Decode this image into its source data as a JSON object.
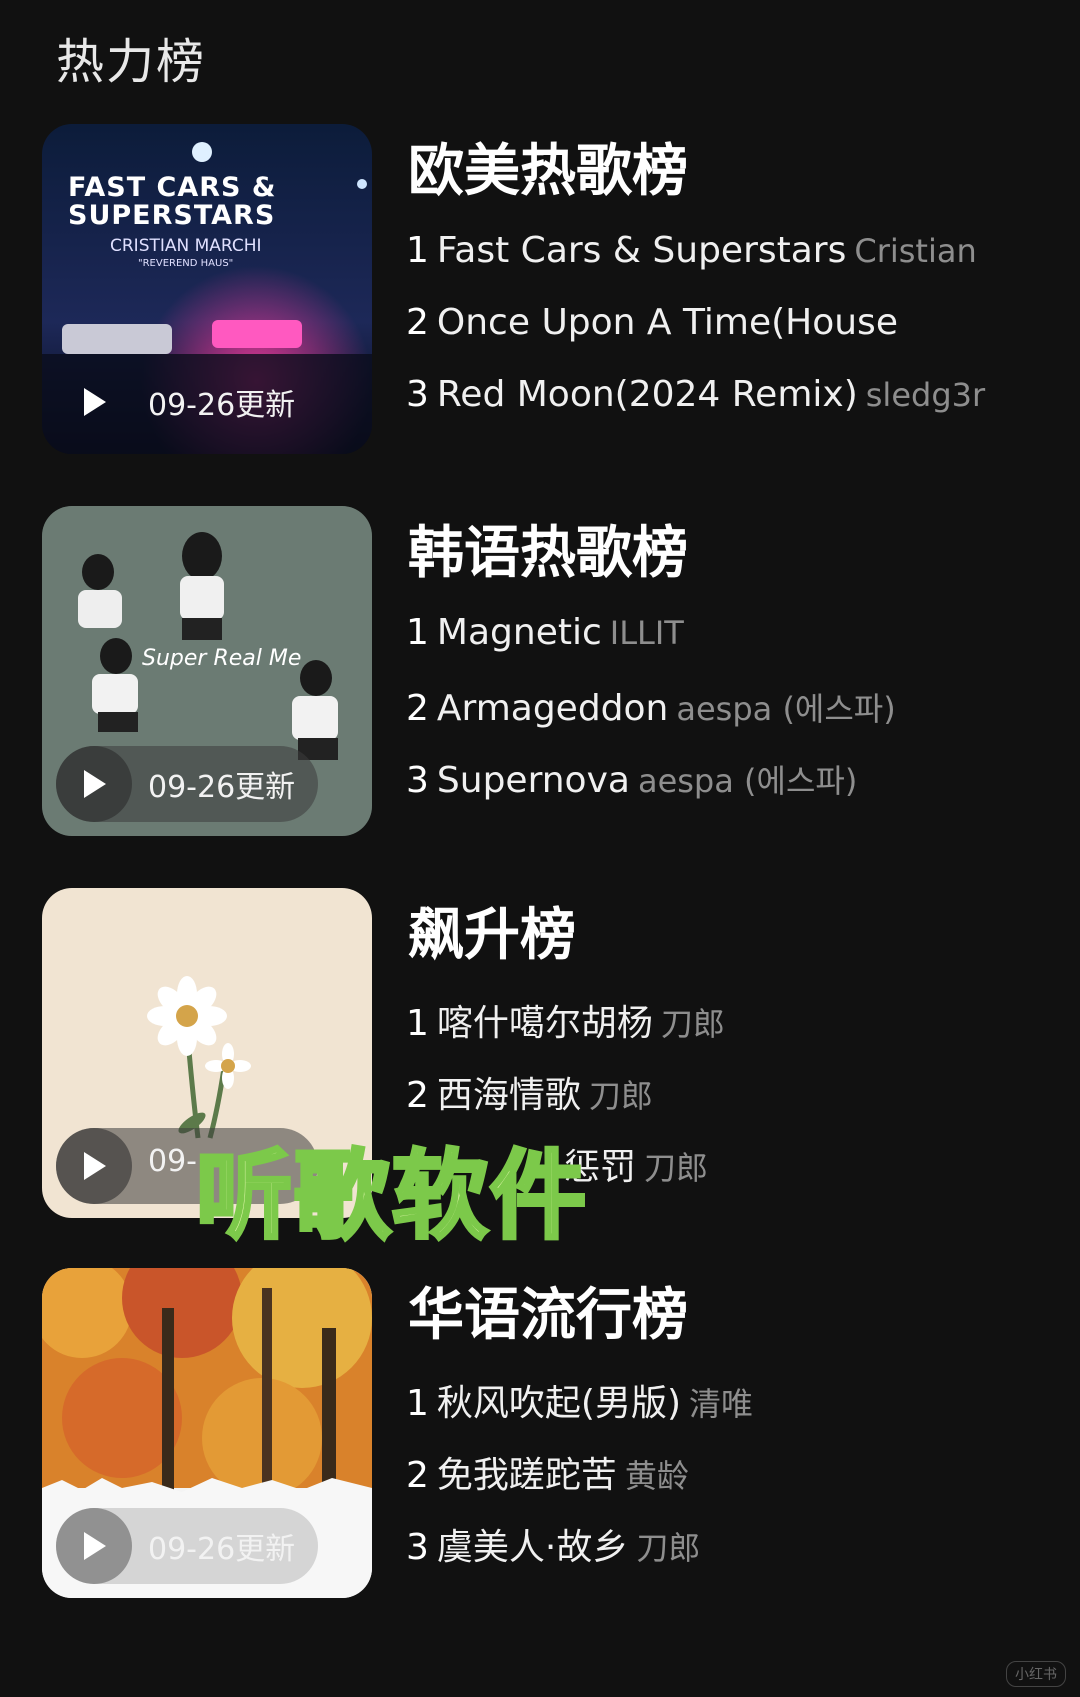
{
  "page": {
    "title": "热力榜"
  },
  "charts": [
    {
      "name": "欧美热歌榜",
      "update": "09-26更新",
      "cover_text": {
        "title": "FAST CARS & SUPERSTARS",
        "artist": "CRISTIAN MARCHI",
        "sub": "\"REVEREND HAUS\""
      },
      "tracks": [
        {
          "rank": "1",
          "title": "Fast Cars & Superstars",
          "artist": "Cristian"
        },
        {
          "rank": "2",
          "title": "Once Upon A Time(House",
          "artist": ""
        },
        {
          "rank": "3",
          "title": "Red Moon(2024 Remix)",
          "artist": "sledg3r"
        }
      ]
    },
    {
      "name": "韩语热歌榜",
      "update": "09-26更新",
      "cover_text": {
        "title": "Super Real Me"
      },
      "tracks": [
        {
          "rank": "1",
          "title": "Magnetic",
          "artist": "ILLIT"
        },
        {
          "rank": "2",
          "title": "Armageddon",
          "artist": "aespa (에스파)"
        },
        {
          "rank": "3",
          "title": "Supernova",
          "artist": "aespa (에스파)"
        }
      ]
    },
    {
      "name": "飙升榜",
      "update": "09-",
      "tracks": [
        {
          "rank": "1",
          "title": "喀什噶尔胡杨",
          "artist": "刀郎"
        },
        {
          "rank": "2",
          "title": "西海情歌",
          "artist": "刀郎"
        },
        {
          "rank": "",
          "title": "惩罚",
          "artist": "刀郎"
        }
      ]
    },
    {
      "name": "华语流行榜",
      "update": "09-26更新",
      "tracks": [
        {
          "rank": "1",
          "title": "秋风吹起(男版)",
          "artist": "清唯"
        },
        {
          "rank": "2",
          "title": "免我蹉跎苦",
          "artist": "黄龄"
        },
        {
          "rank": "3",
          "title": "虞美人·故乡",
          "artist": "刀郎"
        }
      ]
    }
  ],
  "overlay": {
    "text": "听歌软件"
  },
  "watermark": "小红书"
}
